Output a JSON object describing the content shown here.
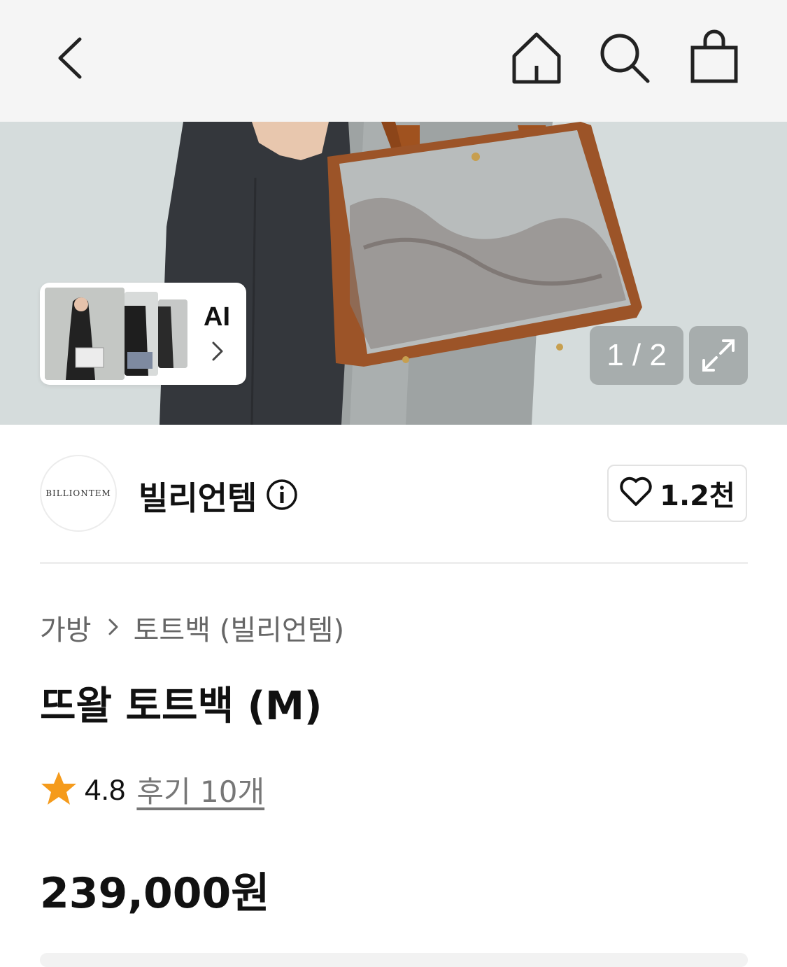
{
  "header": {
    "icons": [
      "back-arrow-icon",
      "home-icon",
      "search-icon",
      "shopping-bag-icon"
    ]
  },
  "gallery": {
    "ai_label": "AI",
    "counter": "1 / 2",
    "current": 1,
    "total": 2
  },
  "brand": {
    "logo_text": "BILLIONTEM",
    "name": "빌리언템",
    "like_count": "1.2천"
  },
  "product": {
    "breadcrumb": [
      "가방",
      "토트백 (빌리언템)"
    ],
    "title": "뜨왈 토트백 (M)",
    "rating": "4.8",
    "reviews": "후기 10개",
    "price": "239,000원"
  },
  "colors": {
    "star": "#f59b1c",
    "header_bg": "#f5f5f5",
    "bag_leather": "#a0521f"
  }
}
